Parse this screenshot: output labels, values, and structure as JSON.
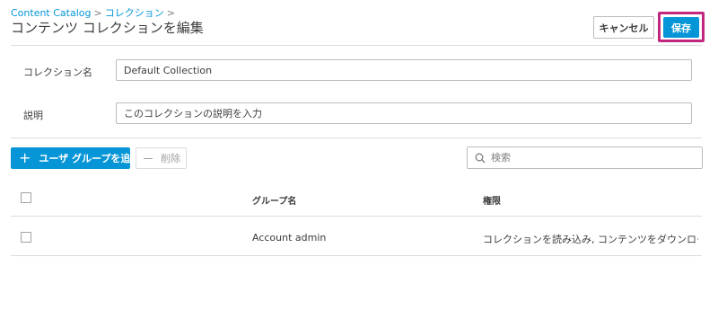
{
  "breadcrumb": {
    "items": [
      "Content Catalog",
      "コレクション"
    ],
    "separator": ">"
  },
  "page_title": "コンテンツ コレクションを編集",
  "actions": {
    "cancel_label": "キャンセル",
    "save_label": "保存"
  },
  "form": {
    "name_label": "コレクション名",
    "name_value": "Default Collection",
    "description_label": "説明",
    "description_placeholder": "このコレクションの説明を入力"
  },
  "toolbar": {
    "add_group_label": "ユーザ グループを追加",
    "delete_label": "削除",
    "search_placeholder": "検索"
  },
  "table": {
    "columns": [
      "グループ名",
      "権限"
    ],
    "rows": [
      {
        "group_name": "Account admin",
        "permissions": "コレクションを読み込み, コンテンツをダウンロード/..."
      }
    ]
  },
  "colors": {
    "accent": "#0696d7",
    "highlight": "#c2277f"
  }
}
